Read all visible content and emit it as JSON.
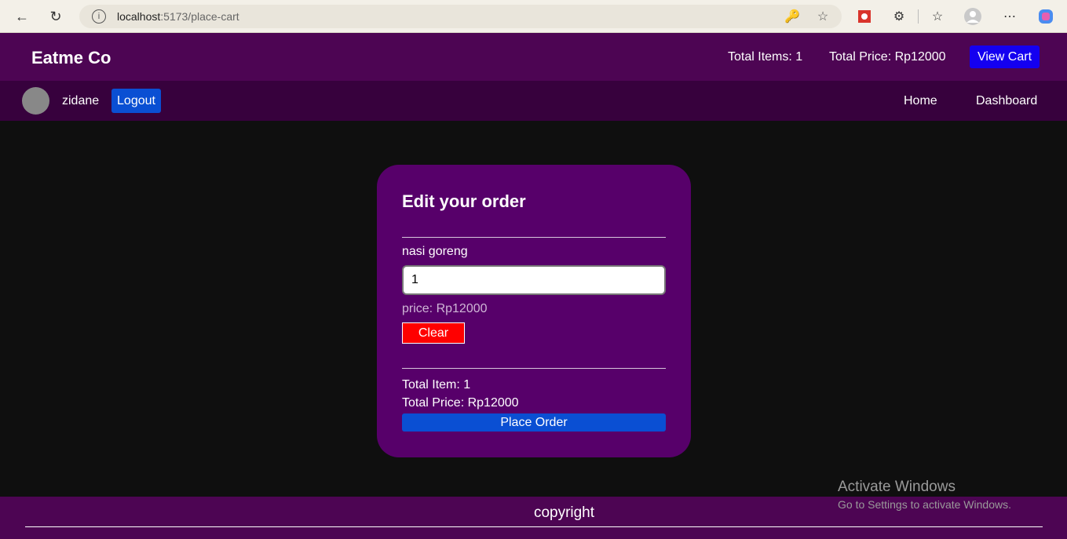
{
  "browser": {
    "url_host": "localhost",
    "url_rest": ":5173/place-cart"
  },
  "header": {
    "brand": "Eatme Co",
    "total_items": "Total Items: 1",
    "total_price": "Total Price: Rp12000",
    "view_cart_label": "View Cart"
  },
  "user_bar": {
    "username": "zidane",
    "logout_label": "Logout",
    "nav": [
      "Home",
      "Dashboard"
    ]
  },
  "order": {
    "title": "Edit your order",
    "item_name": "nasi goreng",
    "quantity": "1",
    "price": "price: Rp12000",
    "clear_label": "Clear",
    "total_item": "Total Item: 1",
    "total_price": "Total Price: Rp12000",
    "place_order_label": "Place Order"
  },
  "watermark": {
    "title": "Activate Windows",
    "subtitle": "Go to Settings to activate Windows."
  },
  "footer": {
    "copyright": "copyright"
  },
  "colors": {
    "header_bg": "#4d0553",
    "subheader_bg": "#37013d",
    "card_bg": "#57006a",
    "page_bg": "#0f0f0f",
    "view_cart_bg": "#1400f0",
    "primary_button": "#0a4fd3",
    "clear_button": "#ff0000"
  }
}
